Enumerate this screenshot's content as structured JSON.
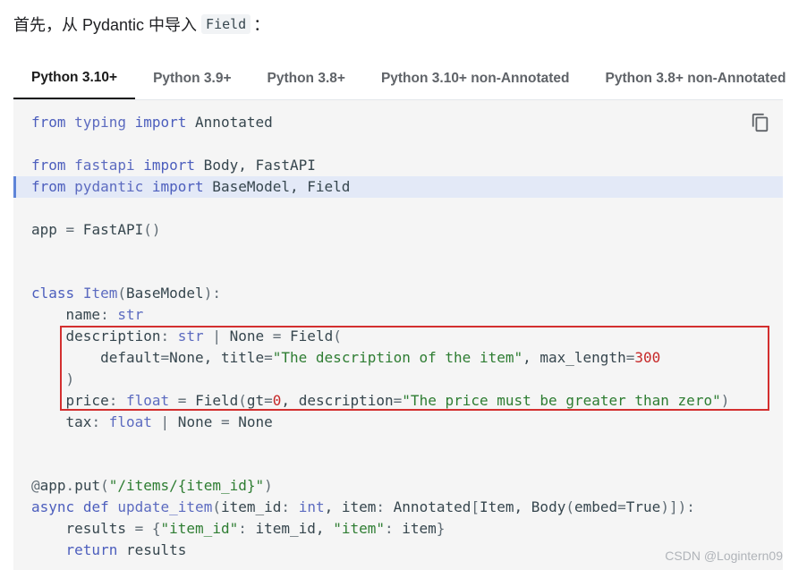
{
  "intro": {
    "text": "首先，从 Pydantic 中导入",
    "code": "Field",
    "suffix": "："
  },
  "tabs": [
    {
      "label": "Python 3.10+",
      "active": true
    },
    {
      "label": "Python 3.9+",
      "active": false
    },
    {
      "label": "Python 3.8+",
      "active": false
    },
    {
      "label": "Python 3.10+ non-Annotated",
      "active": false
    },
    {
      "label": "Python 3.8+ non-Annotated",
      "active": false
    }
  ],
  "code": {
    "copy_icon": "copy-icon",
    "highlighted_line": 4,
    "lines": [
      [
        [
          "kw",
          "from"
        ],
        [
          "t",
          " "
        ],
        [
          "ty",
          "typing"
        ],
        [
          "t",
          " "
        ],
        [
          "kw",
          "import"
        ],
        [
          "t",
          " Annotated"
        ]
      ],
      [],
      [
        [
          "kw",
          "from"
        ],
        [
          "t",
          " "
        ],
        [
          "ty",
          "fastapi"
        ],
        [
          "t",
          " "
        ],
        [
          "kw",
          "import"
        ],
        [
          "t",
          " Body, FastAPI"
        ]
      ],
      [
        [
          "kw",
          "from"
        ],
        [
          "t",
          " "
        ],
        [
          "ty",
          "pydantic"
        ],
        [
          "t",
          " "
        ],
        [
          "kw",
          "import"
        ],
        [
          "t",
          " BaseModel, Field"
        ]
      ],
      [],
      [
        [
          "t",
          "app "
        ],
        [
          "pu",
          "="
        ],
        [
          "t",
          " FastAPI"
        ],
        [
          "pu",
          "()"
        ]
      ],
      [],
      [],
      [
        [
          "kw",
          "class"
        ],
        [
          "t",
          " "
        ],
        [
          "fn",
          "Item"
        ],
        [
          "pu",
          "("
        ],
        [
          "t",
          "BaseModel"
        ],
        [
          "pu",
          "):"
        ]
      ],
      [
        [
          "t",
          "    name"
        ],
        [
          "pu",
          ":"
        ],
        [
          "t",
          " "
        ],
        [
          "ty",
          "str"
        ]
      ],
      [
        [
          "t",
          "    description"
        ],
        [
          "pu",
          ":"
        ],
        [
          "t",
          " "
        ],
        [
          "ty",
          "str"
        ],
        [
          "t",
          " "
        ],
        [
          "pu",
          "|"
        ],
        [
          "t",
          " None "
        ],
        [
          "pu",
          "="
        ],
        [
          "t",
          " Field"
        ],
        [
          "pu",
          "("
        ]
      ],
      [
        [
          "t",
          "        default"
        ],
        [
          "pu",
          "="
        ],
        [
          "t",
          "None, title"
        ],
        [
          "pu",
          "="
        ],
        [
          "st",
          "\"The description of the item\""
        ],
        [
          "t",
          ", max_length"
        ],
        [
          "pu",
          "="
        ],
        [
          "nu",
          "300"
        ]
      ],
      [
        [
          "t",
          "    "
        ],
        [
          "pu",
          ")"
        ]
      ],
      [
        [
          "t",
          "    price"
        ],
        [
          "pu",
          ":"
        ],
        [
          "t",
          " "
        ],
        [
          "ty",
          "float"
        ],
        [
          "t",
          " "
        ],
        [
          "pu",
          "="
        ],
        [
          "t",
          " Field"
        ],
        [
          "pu",
          "("
        ],
        [
          "t",
          "gt"
        ],
        [
          "pu",
          "="
        ],
        [
          "nu",
          "0"
        ],
        [
          "t",
          ", description"
        ],
        [
          "pu",
          "="
        ],
        [
          "st",
          "\"The price must be greater than zero\""
        ],
        [
          "pu",
          ")"
        ]
      ],
      [
        [
          "t",
          "    tax"
        ],
        [
          "pu",
          ":"
        ],
        [
          "t",
          " "
        ],
        [
          "ty",
          "float"
        ],
        [
          "t",
          " "
        ],
        [
          "pu",
          "|"
        ],
        [
          "t",
          " None "
        ],
        [
          "pu",
          "="
        ],
        [
          "t",
          " None"
        ]
      ],
      [],
      [],
      [
        [
          "pu",
          "@"
        ],
        [
          "t",
          "app"
        ],
        [
          "pu",
          "."
        ],
        [
          "t",
          "put"
        ],
        [
          "pu",
          "("
        ],
        [
          "st",
          "\"/items/{item_id}\""
        ],
        [
          "pu",
          ")"
        ]
      ],
      [
        [
          "kw",
          "async"
        ],
        [
          "t",
          " "
        ],
        [
          "kw",
          "def"
        ],
        [
          "t",
          " "
        ],
        [
          "fn",
          "update_item"
        ],
        [
          "pu",
          "("
        ],
        [
          "t",
          "item_id"
        ],
        [
          "pu",
          ":"
        ],
        [
          "t",
          " "
        ],
        [
          "ty",
          "int"
        ],
        [
          "t",
          ", item"
        ],
        [
          "pu",
          ":"
        ],
        [
          "t",
          " Annotated"
        ],
        [
          "pu",
          "["
        ],
        [
          "t",
          "Item, Body"
        ],
        [
          "pu",
          "("
        ],
        [
          "t",
          "embed"
        ],
        [
          "pu",
          "="
        ],
        [
          "t",
          "True"
        ],
        [
          "pu",
          ")]):"
        ]
      ],
      [
        [
          "t",
          "    results "
        ],
        [
          "pu",
          "="
        ],
        [
          "t",
          " "
        ],
        [
          "pu",
          "{"
        ],
        [
          "st",
          "\"item_id\""
        ],
        [
          "pu",
          ":"
        ],
        [
          "t",
          " item_id, "
        ],
        [
          "st",
          "\"item\""
        ],
        [
          "pu",
          ":"
        ],
        [
          "t",
          " item"
        ],
        [
          "pu",
          "}"
        ]
      ],
      [
        [
          "t",
          "    "
        ],
        [
          "kw",
          "return"
        ],
        [
          "t",
          " results"
        ]
      ]
    ]
  },
  "watermark": "CSDN @Logintern09"
}
